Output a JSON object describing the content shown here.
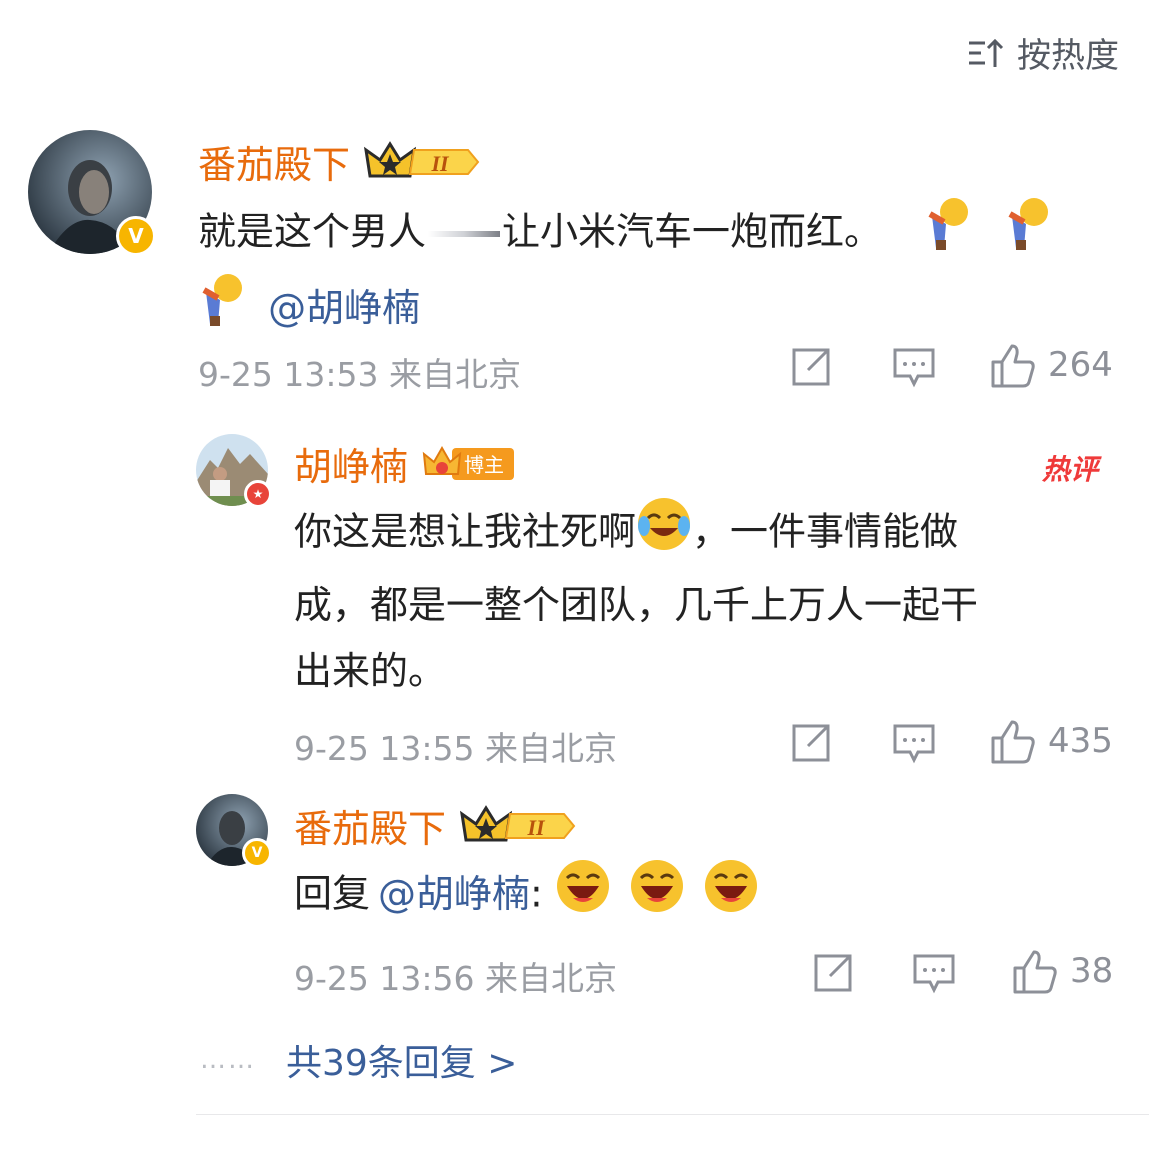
{
  "sort": {
    "label": "按热度",
    "icon": "sort-icon"
  },
  "comment": {
    "username": "番茄殿下",
    "badge_text": "II",
    "text_part1": "就是这个男人",
    "text_part2": "让小米汽车一炮而红。",
    "mention": "@胡峥楠",
    "time": "9-25 13:53",
    "location": "来自北京",
    "likes": "264"
  },
  "replies": [
    {
      "username": "胡峥楠",
      "badge_text": "博主",
      "hot_label": "热评",
      "text_line1": "你这是想让我社死啊",
      "text_line1b": "，一件事情能做",
      "text_line2": "成，都是一整个团队，几千上万人一起干",
      "text_line3": "出来的。",
      "time": "9-25 13:55",
      "location": "来自北京",
      "likes": "435"
    },
    {
      "username": "番茄殿下",
      "badge_text": "II",
      "reply_prefix": "回复",
      "mention": "@胡峥楠",
      "colon": ":",
      "time": "9-25 13:56",
      "location": "来自北京",
      "likes": "38"
    }
  ],
  "more_replies": {
    "dots": "……",
    "label": "共39条回复 >"
  },
  "colors": {
    "username": "#e86b0c",
    "mention": "#3a5e99",
    "meta": "#9a9da3",
    "hot": "#ef3a3a"
  }
}
